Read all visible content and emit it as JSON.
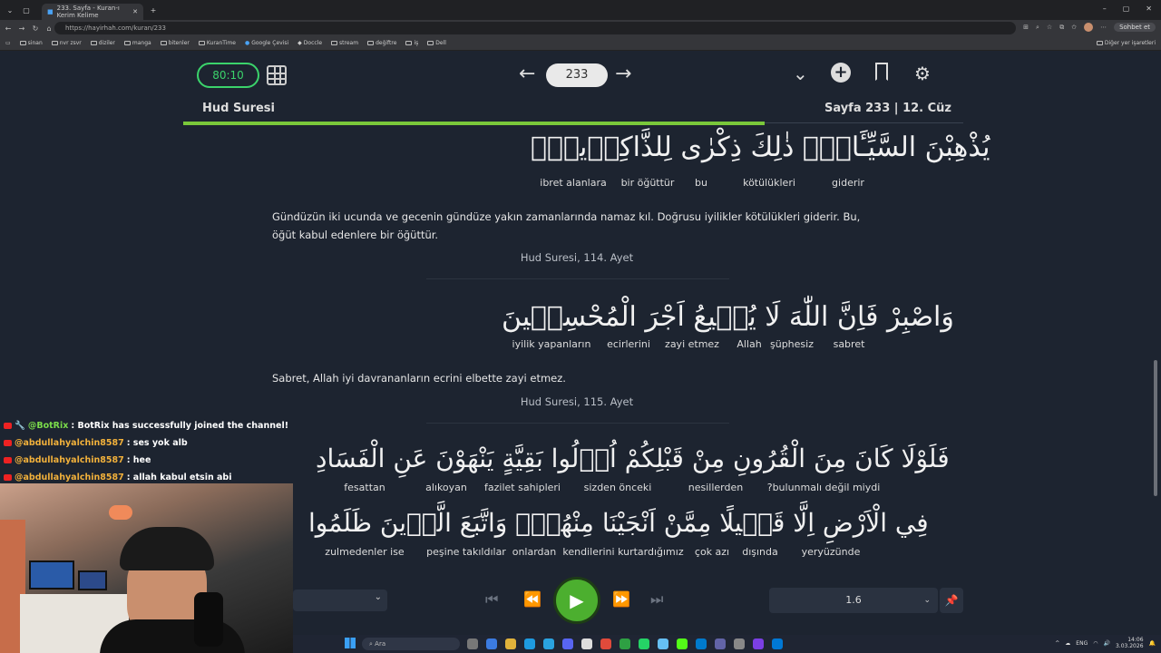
{
  "browser": {
    "tab_title": "233. Sayfa - Kuran-ı Kerim Kelime",
    "url": "https://hayirhah.com/kuran/233",
    "chat_button": "Sohbet et",
    "bookmarks": [
      "sinan",
      "nvr zsvr",
      "diziler",
      "manga",
      "bitenler",
      "KuranTime",
      "Google Çevisi",
      "Doccle",
      "stream",
      "değiftre",
      "iş",
      "Dell"
    ],
    "other_bookmarks": "Diğer yer işaretleri"
  },
  "reader": {
    "timer": "80:10",
    "page_number": "233",
    "sura_name": "Hud Suresi",
    "page_info": "Sayfa 233 | 12. Cüz",
    "progress": 0.745
  },
  "verses": [
    {
      "arabic": "يُذْهِبْنَ السَّيِّـَٔاتِۜ ذٰلِكَ ذِكْرٰى لِلذَّاكِر۪ينَۚ",
      "glosses": [
        "giderir",
        "kötülükleri",
        "bu",
        "bir öğüttür",
        "ibret alanlara"
      ],
      "meaning": "Gündüzün iki ucunda ve gecenin gündüze yakın zamanlarında namaz kıl. Doğrusu iyilikler kötülükleri giderir. Bu, öğüt kabul edenlere bir öğüttür.",
      "reference": "Hud Suresi, 114. Ayet"
    },
    {
      "arabic": "وَاصْبِرْ فَاِنَّ اللّٰهَ لَا يُض۪يعُ اَجْرَ الْمُحْسِن۪ينَ",
      "glosses": [
        "sabret",
        "şüphesiz",
        "Allah",
        "zayi etmez",
        "ecirlerini",
        "iyilik yapanların"
      ],
      "meaning": "Sabret, Allah iyi davrananların ecrini elbette zayi etmez.",
      "reference": "Hud Suresi, 115. Ayet"
    },
    {
      "arabic": "فَلَوْلَا كَانَ مِنَ الْقُرُونِ مِنْ قَبْلِكُمْ اُو۬لُوا بَقِيَّةٍ يَنْهَوْنَ عَنِ الْفَسَادِ",
      "glosses": [
        "bulunmalı değil miydi?",
        "nesillerden",
        "sizden önceki",
        "fazilet sahipleri",
        "alıkoyan",
        "fesattan"
      ],
      "arabic2": "فِي الْاَرْضِ اِلَّا قَل۪يلًا مِمَّنْ اَنْجَيْنَا مِنْهُمْۚ وَاتَّبَعَ الَّذ۪ينَ ظَلَمُوا",
      "glosses2": [
        "yeryüzünde",
        "dışında",
        "çok azı",
        "kendilerini kurtardığımız",
        "onlardan",
        "peşine takıldılar",
        "zulmedenler ise"
      ]
    }
  ],
  "player": {
    "speed": "1.6"
  },
  "chat": [
    {
      "user": "@BotRix",
      "message": ": BotRix has successfully joined the channel!",
      "bot": true
    },
    {
      "user": "@abdullahyalchin8587",
      "message": ": ses yok alb"
    },
    {
      "user": "@abdullahyalchin8587",
      "message": ": hee"
    },
    {
      "user": "@abdullahyalchin8587",
      "message": ": allah kabul etsin abi"
    }
  ],
  "taskbar": {
    "search_placeholder": "Ara",
    "language": "ENG",
    "time": "14:06",
    "date": "3.03.2026"
  }
}
